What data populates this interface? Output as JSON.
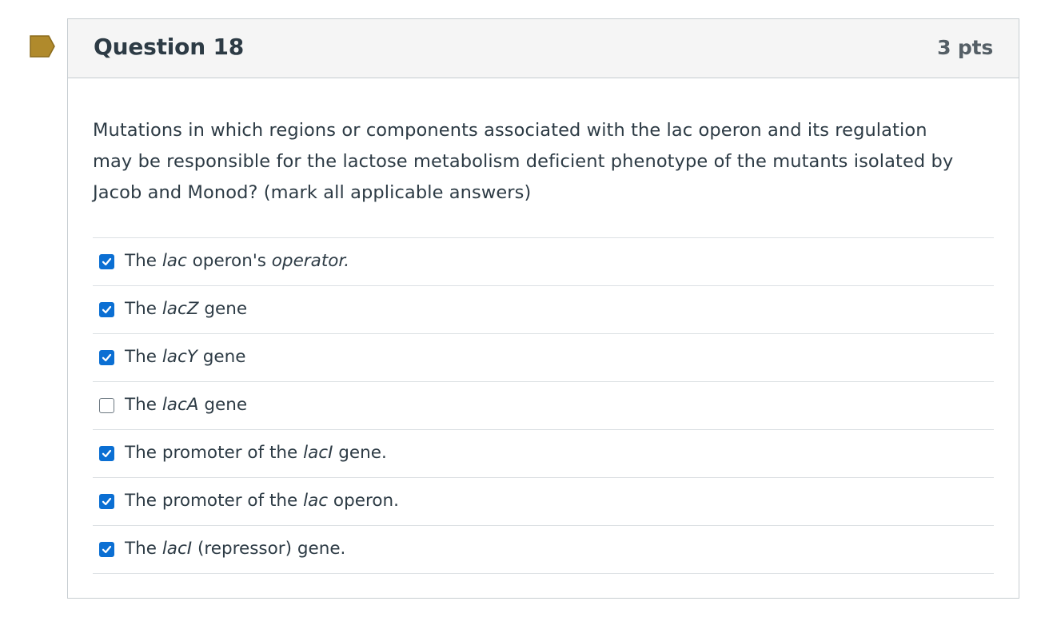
{
  "flag": {
    "icon": "flag-icon",
    "color": "#b08a2c"
  },
  "question": {
    "title": "Question 18",
    "points": "3 pts",
    "prompt": "Mutations in which regions or components associated with the lac operon and its regulation may be responsible for the lactose metabolism deficient phenotype of the mutants isolated by Jacob and Monod? (mark all applicable answers)"
  },
  "answers": [
    {
      "checked": true,
      "parts": [
        {
          "t": "The "
        },
        {
          "t": "lac",
          "i": true
        },
        {
          "t": " operon's "
        },
        {
          "t": "operator.",
          "i": true
        }
      ]
    },
    {
      "checked": true,
      "parts": [
        {
          "t": "The "
        },
        {
          "t": "lacZ",
          "i": true
        },
        {
          "t": " gene"
        }
      ]
    },
    {
      "checked": true,
      "parts": [
        {
          "t": "The "
        },
        {
          "t": "lacY",
          "i": true
        },
        {
          "t": " gene"
        }
      ]
    },
    {
      "checked": false,
      "parts": [
        {
          "t": "The "
        },
        {
          "t": "lacA",
          "i": true
        },
        {
          "t": " gene"
        }
      ]
    },
    {
      "checked": true,
      "parts": [
        {
          "t": "The promoter of the "
        },
        {
          "t": "lacI",
          "i": true
        },
        {
          "t": " gene."
        }
      ]
    },
    {
      "checked": true,
      "parts": [
        {
          "t": "The promoter of the "
        },
        {
          "t": "lac",
          "i": true
        },
        {
          "t": " operon."
        }
      ]
    },
    {
      "checked": true,
      "parts": [
        {
          "t": "The "
        },
        {
          "t": "lacI",
          "i": true
        },
        {
          "t": " (repressor) gene."
        }
      ]
    }
  ],
  "colors": {
    "checkbox_checked": "#0b6fd3",
    "header_bg": "#f5f5f5",
    "border": "#c7cdd1",
    "text": "#2d3b45"
  }
}
